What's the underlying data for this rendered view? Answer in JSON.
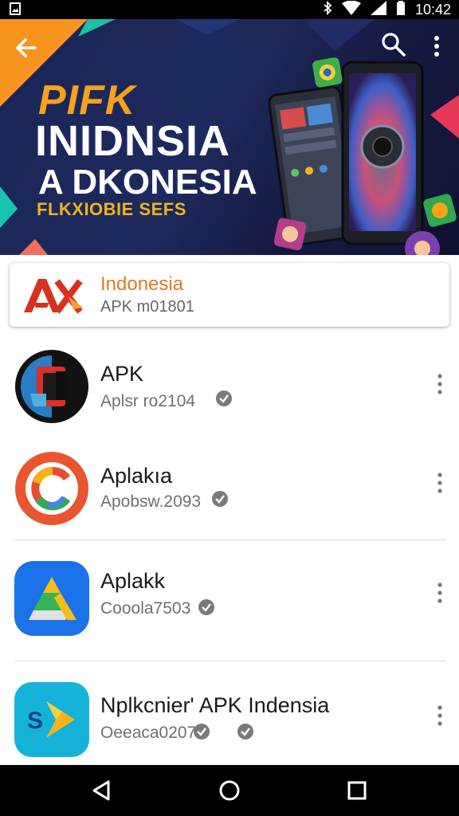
{
  "status_bar": {
    "time": "10:42"
  },
  "banner": {
    "line1": "PIFK",
    "line2": "INIDNSIA",
    "line3": "A DKONESIA",
    "line4": "FLKXIOBIE SEFS"
  },
  "featured": {
    "title": "Indonesia",
    "subtitle": "APK m01801"
  },
  "apps": [
    {
      "title": "APK",
      "subtitle": "Aplsr ro2104",
      "icon": "app-icon-dark-ring"
    },
    {
      "title": "Aplakıa",
      "subtitle": "Apobsw.2093",
      "icon": "app-icon-orange-c"
    },
    {
      "title": "Aplakk",
      "subtitle": "Cooola7503",
      "icon": "app-icon-blue-triangle"
    },
    {
      "title": "Nplkcnier' APK Indensia",
      "subtitle": "Oeeaca0207",
      "icon": "app-icon-cyan-arrow"
    }
  ],
  "colors": {
    "accent": "#f7a21b",
    "banner_bg": "#1d2a5e",
    "featured_title": "#e07a1e"
  }
}
